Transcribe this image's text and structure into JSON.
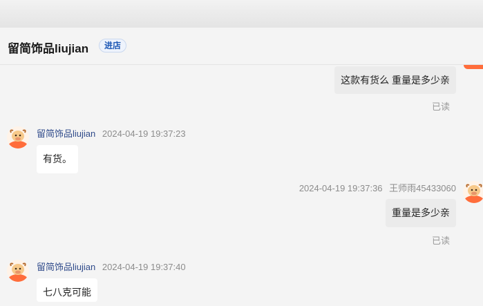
{
  "header": {
    "shop_name": "留简饰品liujian",
    "enter_shop_label": "进店"
  },
  "messages": [
    {
      "direction": "outgoing",
      "text": "这款有货么 重量是多少亲",
      "status": "已读"
    },
    {
      "direction": "incoming",
      "sender": "留简饰品liujian",
      "time": "2024-04-19 19:37:23",
      "text": "有货。"
    },
    {
      "direction": "outgoing",
      "sender": "王师雨45433060",
      "time": "2024-04-19 19:37:36",
      "text": "重量是多少亲",
      "status": "已读"
    },
    {
      "direction": "incoming",
      "sender": "留简饰品liujian",
      "time": "2024-04-19 19:37:40",
      "text": "七八克可能"
    }
  ],
  "icons": {
    "shop_avatar": "cartoon-bull-avatar-icon",
    "user_avatar": "cartoon-bull-avatar-icon"
  },
  "colors": {
    "accent": "#ff6d3b",
    "link_blue": "#1e58b5",
    "sender_name": "#2f4a8a",
    "outgoing_bubble": "#ebebeb",
    "incoming_bubble": "#ffffff"
  }
}
